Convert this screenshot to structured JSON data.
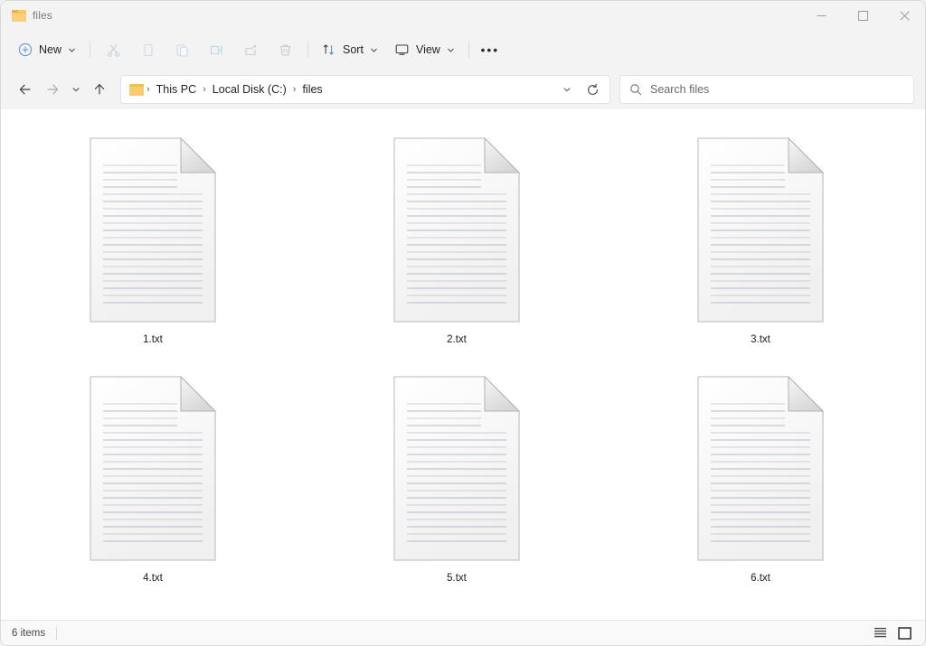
{
  "window": {
    "title": "files",
    "title_icon": "folder-icon",
    "controls": {
      "minimize": "─",
      "maximize": "□",
      "close": "✕"
    }
  },
  "toolbar": {
    "new_label": "New",
    "new_icon": "circle-plus-icon",
    "actions": [
      {
        "name": "cut",
        "icon": "scissors-icon",
        "enabled": false
      },
      {
        "name": "copy",
        "icon": "copy-icon",
        "enabled": false
      },
      {
        "name": "paste",
        "icon": "clipboard-paste-icon",
        "enabled": false
      },
      {
        "name": "rename",
        "icon": "rename-tag-icon",
        "enabled": false
      },
      {
        "name": "share",
        "icon": "share-arrow-icon",
        "enabled": false
      },
      {
        "name": "delete",
        "icon": "trash-icon",
        "enabled": false
      }
    ],
    "sort_label": "Sort",
    "sort_icon": "sort-arrows-icon",
    "view_label": "View",
    "view_icon": "monitor-icon",
    "more_label": "•••"
  },
  "navigation": {
    "back_icon": "arrow-left-icon",
    "forward_icon": "arrow-right-icon",
    "recent_icon": "chevron-down-icon",
    "up_icon": "arrow-up-icon"
  },
  "address": {
    "folder_icon": "folder-icon",
    "separator": "›",
    "crumbs": [
      "This PC",
      "Local Disk (C:)",
      "files"
    ],
    "dropdown_icon": "chevron-down-icon",
    "refresh_icon": "refresh-icon"
  },
  "search": {
    "icon": "search-icon",
    "placeholder": "Search files",
    "value": ""
  },
  "files": [
    {
      "name": "1.txt",
      "icon": "text-file-icon"
    },
    {
      "name": "2.txt",
      "icon": "text-file-icon"
    },
    {
      "name": "3.txt",
      "icon": "text-file-icon"
    },
    {
      "name": "4.txt",
      "icon": "text-file-icon"
    },
    {
      "name": "5.txt",
      "icon": "text-file-icon"
    },
    {
      "name": "6.txt",
      "icon": "text-file-icon"
    }
  ],
  "statusbar": {
    "item_count": "6 items",
    "details_view_icon": "list-details-icon",
    "large_icons_view_icon": "large-icons-icon"
  },
  "colors": {
    "chrome": "#f3f3f3",
    "content": "#ffffff",
    "accent_blue": "#6aa9e0",
    "folder_yellow": "#f8cd6e",
    "text": "#1f1f1f"
  }
}
